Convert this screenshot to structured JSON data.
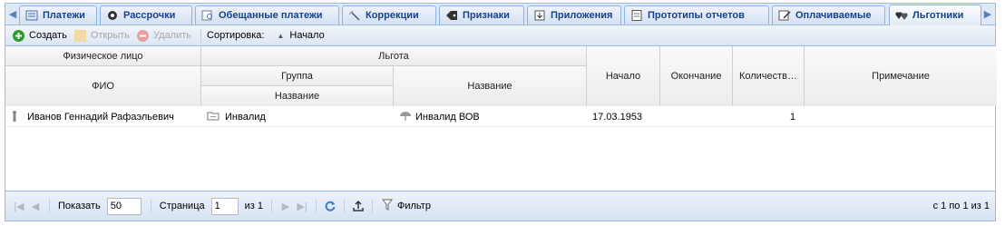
{
  "tabs": [
    {
      "label": "Платежи",
      "icon": "list-icon"
    },
    {
      "label": "Рассрочки",
      "icon": "gear-icon"
    },
    {
      "label": "Обещанные платежи",
      "icon": "search-document-icon"
    },
    {
      "label": "Коррекции",
      "icon": "wand-icon"
    },
    {
      "label": "Признаки",
      "icon": "tag-icon"
    },
    {
      "label": "Приложения",
      "icon": "download-icon"
    },
    {
      "label": "Прототипы отчетов",
      "icon": "report-icon"
    },
    {
      "label": "Оплачиваемые",
      "icon": "edit-document-icon"
    },
    {
      "label": "Льготники",
      "icon": "hearts-icon",
      "active": true
    }
  ],
  "toolbar": {
    "create_label": "Создать",
    "open_label": "Открыть",
    "delete_label": "Удалить",
    "sort_label": "Сортировка:",
    "sort_value": "Начало"
  },
  "grid": {
    "headers": {
      "person_group": "Физическое лицо",
      "fio": "ФИО",
      "benefit_group": "Льгота",
      "group": "Группа",
      "group_name": "Название",
      "name": "Название",
      "start": "Начало",
      "end": "Окончание",
      "count": "Количеств…",
      "note": "Примечание"
    },
    "rows": [
      {
        "fio": "Иванов Геннадий Рафаэльевич",
        "group_name": "Инвалид",
        "name": "Инвалид ВОВ",
        "start": "17.03.1953",
        "end": "",
        "count": "1",
        "note": ""
      }
    ]
  },
  "pager": {
    "show_label": "Показать",
    "page_size": "50",
    "page_label": "Страница",
    "page_value": "1",
    "of_label": "из 1",
    "filter_label": "Фильтр",
    "summary": "с 1 по 1 из 1"
  },
  "colors": {
    "accent": "#15428b",
    "border": "#99bbe8",
    "create": "#2e9a2e",
    "delete": "#e0645f"
  }
}
